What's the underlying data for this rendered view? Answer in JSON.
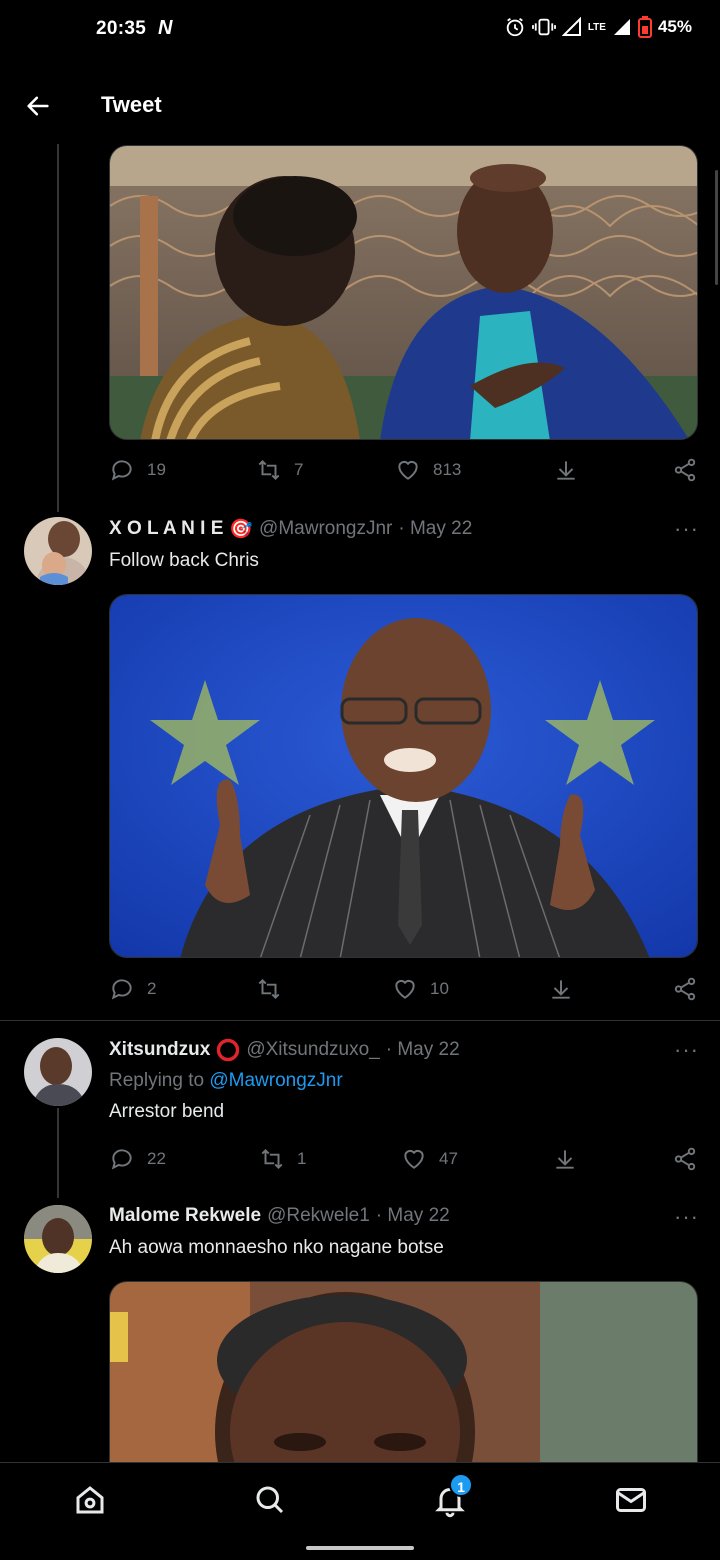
{
  "status_bar": {
    "time": "20:35",
    "network_logo": "N",
    "lte": "LTE",
    "battery": "45%",
    "icons": [
      "alarm-icon",
      "vibrate-icon",
      "signal-icon",
      "signal-icon",
      "battery-icon"
    ]
  },
  "header": {
    "title": "Tweet",
    "back_icon": "arrow-left-icon"
  },
  "tweets": [
    {
      "media_desc_icon": "photo",
      "actions": {
        "replies": "19",
        "retweets": "7",
        "likes": "813"
      }
    },
    {
      "name": "X O L A N I E",
      "name_emoji": "🎯",
      "handle": "@MawrongzJnr",
      "date": "· May 22",
      "text": "Follow back Chris",
      "actions": {
        "replies": "2",
        "retweets": "",
        "likes": "10"
      }
    },
    {
      "name": "Xitsundzux",
      "handle": "@Xitsundzuxo_",
      "date": "· May 22",
      "replying_prefix": "Replying to",
      "replying_to": "@MawrongzJnr",
      "text": "Arrestor bend",
      "actions": {
        "replies": "22",
        "retweets": "1",
        "likes": "47"
      }
    },
    {
      "name": "Malome Rekwele",
      "handle": "@Rekwele1",
      "date": "· May 22",
      "text": "Ah aowa monnaesho nko nagane botse"
    }
  ],
  "more_label": "···",
  "bottom_nav": {
    "items": [
      "home-icon",
      "search-icon",
      "notifications-icon",
      "messages-icon"
    ],
    "notifications_badge": "1"
  },
  "colors": {
    "accent": "#1d9bf0",
    "background": "#000000",
    "muted": "#71767b",
    "text": "#e7e9ea"
  }
}
